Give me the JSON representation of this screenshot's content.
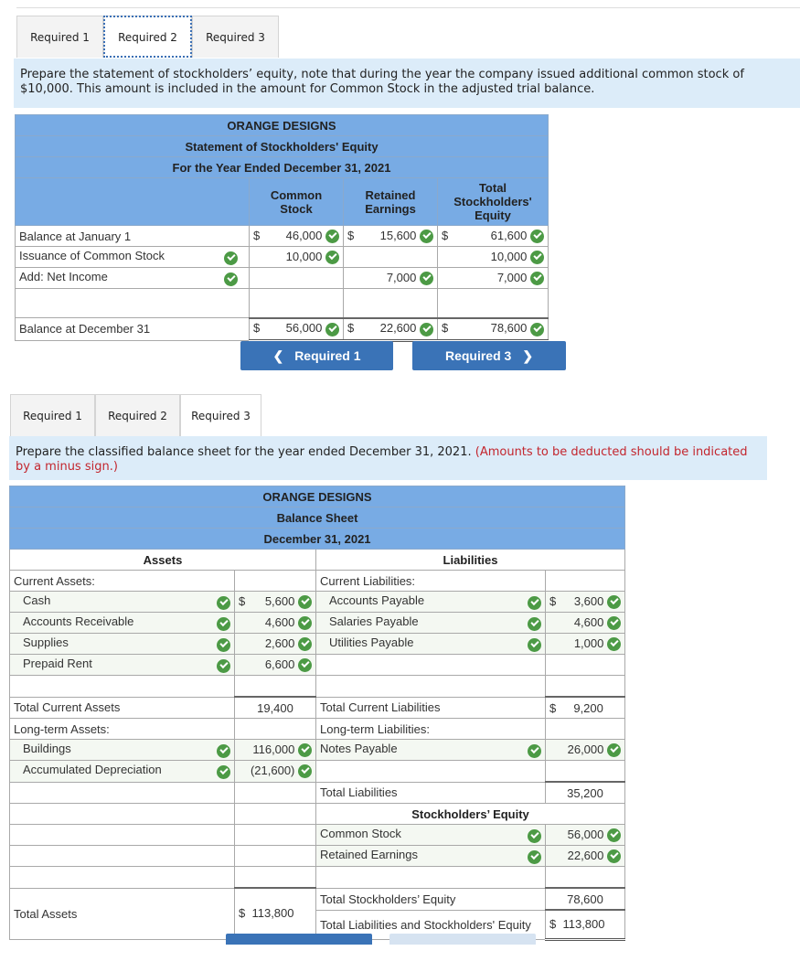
{
  "section1": {
    "tabs": [
      "Required 1",
      "Required 2",
      "Required 3"
    ],
    "active_tab": 1,
    "instruction": "Prepare the statement of stockholders’ equity, note that during the year the company issued additional common stock of $10,000. This amount is included in the amount for Common Stock in the adjusted trial balance.",
    "table": {
      "company": "ORANGE DESIGNS",
      "title": "Statement of Stockholders' Equity",
      "period": "For the Year Ended December 31, 2021",
      "columns": [
        "Common Stock",
        "Retained Earnings",
        "Total Stockholders' Equity"
      ],
      "rows": [
        {
          "label": "Balance at January 1",
          "cs": "46,000",
          "re": "15,600",
          "total": "61,600"
        },
        {
          "label": "Issuance of Common Stock",
          "cs": "10,000",
          "re": "",
          "total": "10,000"
        },
        {
          "label": "Add: Net Income",
          "cs": "",
          "re": "7,000",
          "total": "7,000"
        },
        {
          "label": "",
          "cs": "",
          "re": "",
          "total": ""
        },
        {
          "label": "Balance at December 31",
          "cs": "56,000",
          "re": "22,600",
          "total": "78,600"
        }
      ],
      "currency": "$"
    },
    "prev_button": "Required 1",
    "next_button": "Required 3"
  },
  "section2": {
    "tabs": [
      "Required 1",
      "Required 2",
      "Required 3"
    ],
    "active_tab": 2,
    "instruction": "Prepare the classified balance sheet for the year ended December 31, 2021.",
    "instruction_note": "(Amounts to be deducted should be indicated by a minus sign.)",
    "table": {
      "company": "ORANGE DESIGNS",
      "title": "Balance Sheet",
      "date": "December 31, 2021",
      "assets_header": "Assets",
      "liabilities_header": "Liabilities",
      "equity_header": "Stockholders’ Equity",
      "currency": "$",
      "current_assets_label": "Current Assets:",
      "current_assets": [
        {
          "label": "Cash",
          "value": "5,600"
        },
        {
          "label": "Accounts Receivable",
          "value": "4,600"
        },
        {
          "label": "Supplies",
          "value": "2,600"
        },
        {
          "label": "Prepaid Rent",
          "value": "6,600"
        }
      ],
      "total_current_assets_label": "Total Current Assets",
      "total_current_assets": "19,400",
      "long_term_assets_label": "Long-term Assets:",
      "long_term_assets": [
        {
          "label": "Buildings",
          "value": "116,000"
        },
        {
          "label": "Accumulated Depreciation",
          "value": "(21,600)"
        }
      ],
      "total_assets_label": "Total Assets",
      "total_assets": "113,800",
      "current_liabilities_label": "Current Liabilities:",
      "current_liabilities": [
        {
          "label": "Accounts Payable",
          "value": "3,600"
        },
        {
          "label": "Salaries Payable",
          "value": "4,600"
        },
        {
          "label": "Utilities Payable",
          "value": "1,000"
        }
      ],
      "total_current_liabilities_label": "Total Current Liabilities",
      "total_current_liabilities": "9,200",
      "long_term_liabilities_label": "Long-term Liabilities:",
      "long_term_liabilities": [
        {
          "label": "Notes Payable",
          "value": "26,000"
        }
      ],
      "total_liabilities_label": "Total Liabilities",
      "total_liabilities": "35,200",
      "equity": [
        {
          "label": "Common Stock",
          "value": "56,000"
        },
        {
          "label": "Retained Earnings",
          "value": "22,600"
        }
      ],
      "total_equity_label": "Total Stockholders’ Equity",
      "total_equity": "78,600",
      "total_le_label": "Total Liabilities and Stockholders' Equity",
      "total_le": "113,800"
    }
  },
  "colors": {
    "header_blue": "#78abe4",
    "button_blue": "#3a73b7",
    "check_green": "#4c9a45",
    "instruction_bg": "#dcecf9",
    "note_red": "#c3262e"
  }
}
